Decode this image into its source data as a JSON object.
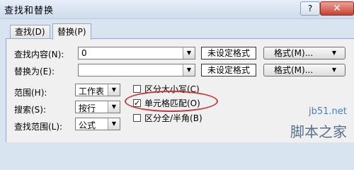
{
  "window": {
    "title": "查找和替换",
    "help_glyph": "?",
    "close_glyph": "✕"
  },
  "tabs": [
    {
      "label": "查找(D)",
      "active": false
    },
    {
      "label": "替换(P)",
      "active": true
    }
  ],
  "find_what": {
    "label": "查找内容(N):",
    "value": "0",
    "format_status": "未设定格式"
  },
  "replace_with": {
    "label": "替换为(E):",
    "value": "",
    "format_status": "未设定格式"
  },
  "format_button_label": "格式(M)...",
  "within": {
    "label": "范围(H):",
    "value": "工作表"
  },
  "search": {
    "label": "搜索(S):",
    "value": "按行"
  },
  "look_in": {
    "label": "查找范围(L):",
    "value": "公式"
  },
  "options": {
    "match_case": {
      "label": "区分大小写(C)",
      "checked": false
    },
    "match_entire_cell": {
      "label": "单元格匹配(O)",
      "checked": true
    },
    "match_byte": {
      "label": "区分全/半角(B)",
      "checked": false
    }
  },
  "checkmark": "✓",
  "combo_arrow": "▼",
  "watermark": {
    "site": "jb51.net",
    "brand": "脚本之家"
  },
  "colors": {
    "highlight_circle": "#c83a3a",
    "close_button": "#c8412f"
  }
}
